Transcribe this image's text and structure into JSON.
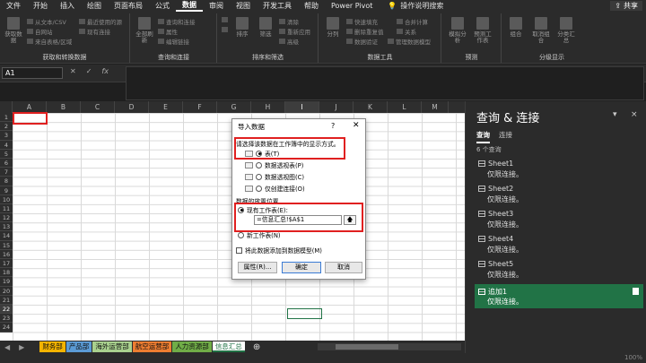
{
  "menu": {
    "items": [
      "文件",
      "开始",
      "插入",
      "绘图",
      "页面布局",
      "公式",
      "数据",
      "审阅",
      "视图",
      "开发工具",
      "帮助",
      "Power Pivot"
    ],
    "active": "数据",
    "search_label": "操作说明搜索",
    "share_label": "共享"
  },
  "ribbon": {
    "groups": {
      "get_transform": "获取和转换数据",
      "query_connect": "查询和连接",
      "sort_filter": "排序和筛选",
      "data_tools": "数据工具",
      "forecast": "预测",
      "outline": "分级显示"
    },
    "get_data_label": "获取数据",
    "from_text_csv": "从文本/CSV",
    "from_web": "自网站",
    "from_table": "来自表格/区域",
    "recent_sources": "最近使用的源",
    "existing_conn": "现有连接",
    "refresh_all": "全部刷新",
    "queries_conn": "查询和连接",
    "properties": "属性",
    "edit_links": "编辑链接",
    "sort": "排序",
    "filter": "筛选",
    "clear": "清除",
    "reapply": "重新应用",
    "advanced": "高级",
    "split": "分列",
    "flash_fill": "快速填充",
    "remove_dup": "删除重复值",
    "validation": "数据验证",
    "consolidate": "合并计算",
    "relationships": "关系",
    "manage_model": "管理数据模型",
    "what_if": "模拟分析",
    "forecast_sheet": "预测工作表",
    "group": "组合",
    "ungroup": "取消组合",
    "subtotal": "分类汇总"
  },
  "formula_bar": {
    "name_box": "A1",
    "cancel": "✕",
    "enter": "✓",
    "fx": "fx"
  },
  "grid": {
    "columns": [
      "A",
      "B",
      "C",
      "D",
      "E",
      "F",
      "G",
      "H",
      "I",
      "J",
      "K",
      "L",
      "M"
    ],
    "selected_column": "I",
    "rows": [
      "1",
      "2",
      "3",
      "4",
      "5",
      "6",
      "7",
      "8",
      "9",
      "10",
      "11",
      "12",
      "13",
      "14",
      "15",
      "16",
      "17",
      "18",
      "19",
      "20",
      "21",
      "22",
      "23",
      "24"
    ],
    "selected_row": "22"
  },
  "sheet_tabs": [
    {
      "label": "财务部",
      "color": "#f4b400"
    },
    {
      "label": "产品部",
      "color": "#5b9bd5"
    },
    {
      "label": "海外运营部",
      "color": "#a9d18e"
    },
    {
      "label": "航空运营部",
      "color": "#ed7d31"
    },
    {
      "label": "人力资源部",
      "color": "#70ad47"
    },
    {
      "label": "信息汇总",
      "color": "#ffffff",
      "active": true
    }
  ],
  "sheet_nav": {
    "prev": "◀",
    "next": "▶",
    "add": "⊕"
  },
  "status": {
    "zoom": "100%"
  },
  "pane": {
    "title": "查询 & 连接",
    "close": "×",
    "menu": "▾",
    "tabs": [
      "查询",
      "连接"
    ],
    "count": "6 个查询",
    "queries": [
      {
        "name": "Sheet1",
        "status": "仅限连接。"
      },
      {
        "name": "Sheet2",
        "status": "仅限连接。"
      },
      {
        "name": "Sheet3",
        "status": "仅限连接。"
      },
      {
        "name": "Sheet4",
        "status": "仅限连接。"
      },
      {
        "name": "Sheet5",
        "status": "仅限连接。"
      },
      {
        "name": "追加1",
        "status": "仅限连接。",
        "selected": true
      }
    ]
  },
  "dialog": {
    "title": "导入数据",
    "help": "?",
    "close": "✕",
    "select_view_label": "请选择该数据在工作簿中的显示方式。",
    "options": [
      "表(T)",
      "数据透视表(P)",
      "数据透视图(C)",
      "仅创建连接(O)"
    ],
    "selected_option": "表(T)",
    "location_label": "数据的放置位置",
    "existing_sheet": "现有工作表(E):",
    "range_value": "=信息汇总!$A$1",
    "range_btn": "🡅",
    "new_sheet": "新工作表(N)",
    "add_model": "将此数据添加到数据模型(M)",
    "properties_btn": "属性(R)...",
    "ok_btn": "确定",
    "cancel_btn": "取消"
  }
}
